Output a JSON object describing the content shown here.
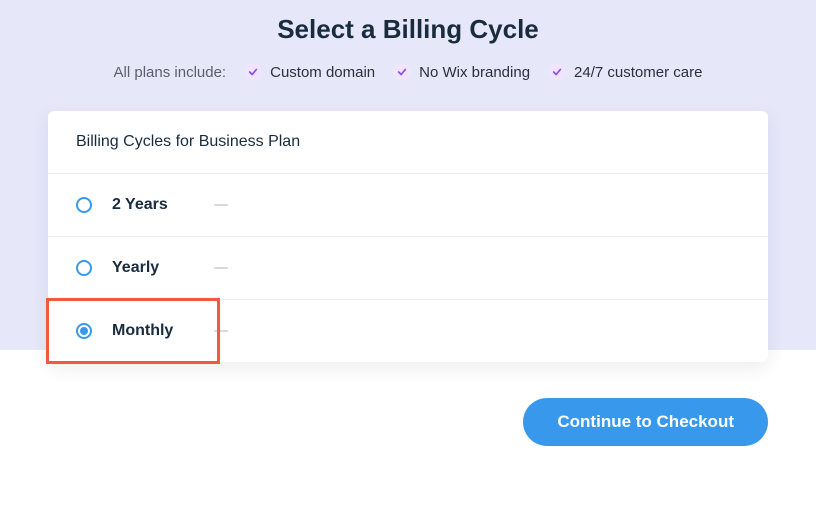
{
  "title": "Select a Billing Cycle",
  "features": {
    "lead": "All plans include:",
    "items": [
      "Custom domain",
      "No Wix branding",
      "24/7 customer care"
    ]
  },
  "card": {
    "header": "Billing Cycles for Business Plan",
    "options": [
      {
        "label": "2 Years",
        "selected": false
      },
      {
        "label": "Yearly",
        "selected": false
      },
      {
        "label": "Monthly",
        "selected": true
      }
    ]
  },
  "cta": "Continue to Checkout"
}
